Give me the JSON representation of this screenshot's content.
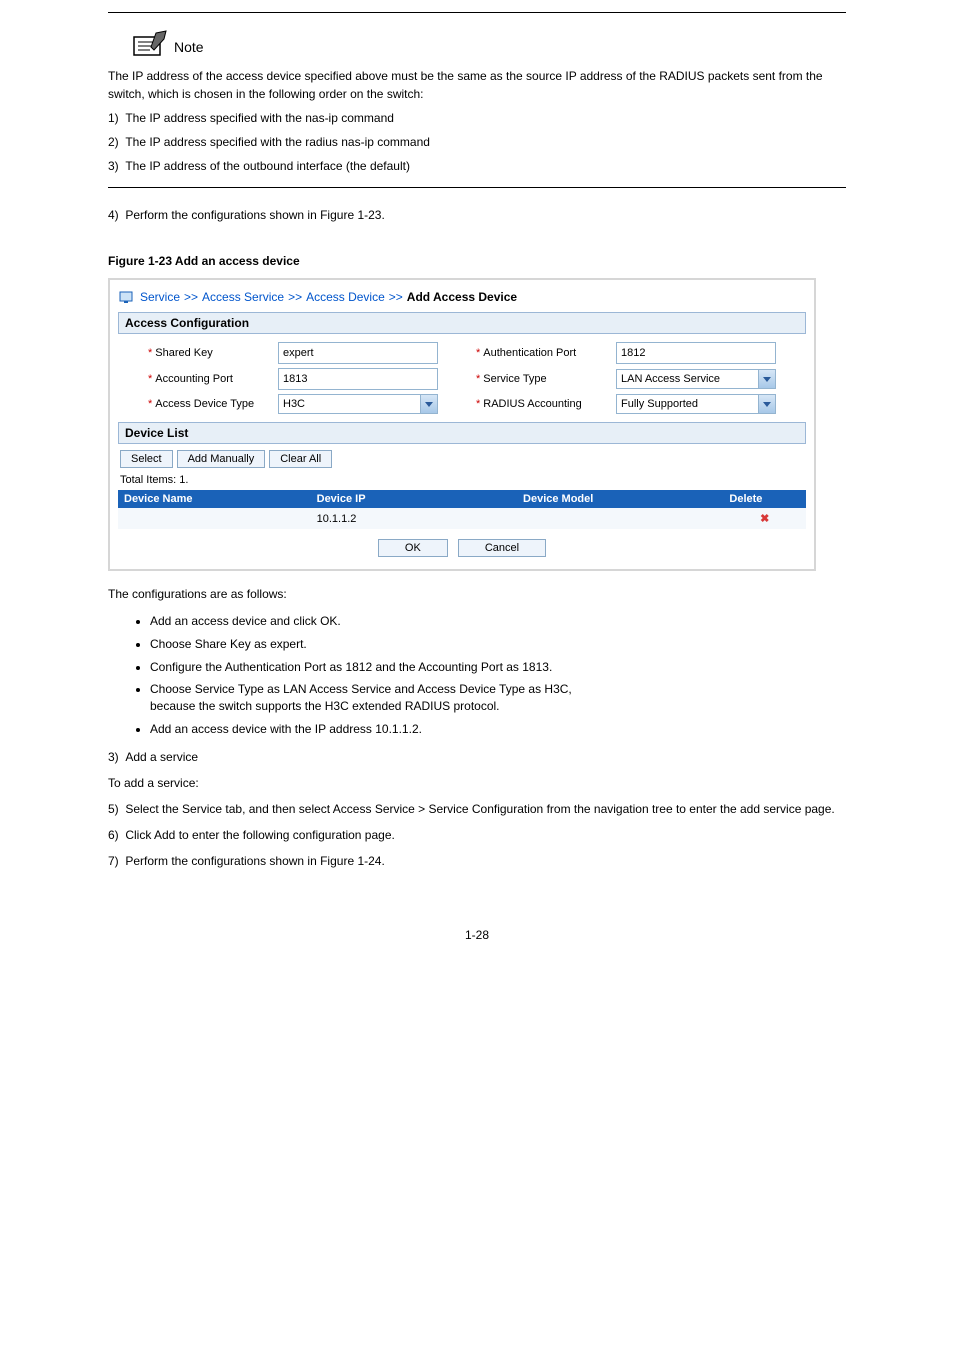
{
  "topRule": true,
  "noteLabel": "Note",
  "noteLines": [
    "The IP address of the access device specified above must be the same as the source IP address of the RADIUS packets sent from the switch, which is chosen in the following order on the switch:",
    "1)  The IP address specified with the nas-ip command",
    "2)  The IP address specified with the radius nas-ip command",
    "3)  The IP address of the outbound interface (the default)"
  ],
  "afterNotePara": "4)  Perform the configurations shown in Figure 1-23.",
  "figure": {
    "caption": "Figure 1-23 Add an access device",
    "breadcrumb": {
      "items": [
        "Service",
        "Access Service",
        "Access Device"
      ],
      "last": "Add Access Device"
    },
    "panels": {
      "accessConfig": {
        "title": "Access Configuration"
      },
      "deviceList": {
        "title": "Device List"
      }
    },
    "form": {
      "sharedKey": {
        "label": "Shared Key",
        "value": "expert"
      },
      "authPort": {
        "label": "Authentication Port",
        "value": "1812"
      },
      "accountingPort": {
        "label": "Accounting Port",
        "value": "1813"
      },
      "serviceType": {
        "label": "Service Type",
        "value": "LAN Access Service"
      },
      "deviceType": {
        "label": "Access Device Type",
        "value": "H3C"
      },
      "radiusAcct": {
        "label": "RADIUS Accounting",
        "value": "Fully Supported"
      }
    },
    "toolbar": {
      "select": "Select",
      "addManual": "Add Manually",
      "clearAll": "Clear All"
    },
    "totalItems": "Total Items: 1.",
    "tableHeaders": {
      "name": "Device Name",
      "ip": "Device IP",
      "model": "Device Model",
      "del": "Delete"
    },
    "rows": [
      {
        "name": "",
        "ip": "10.1.1.2",
        "model": ""
      }
    ],
    "buttons": {
      "ok": "OK",
      "cancel": "Cancel"
    }
  },
  "afterFigurePara": "The configurations are as follows:",
  "confList": [
    "Add an access device and click OK.",
    "Choose Share Key as expert.",
    "Configure the Authentication Port as 1812 and the Accounting Port as 1813.",
    "Choose Service Type as LAN Access Service and Access Device Type as H3C,",
    "because the switch supports the H3C extended RADIUS protocol.",
    "Add an access device with the IP address 10.1.1.2."
  ],
  "heading3": "3)  Add a service",
  "instr3": [
    "To add a service:",
    "5)  Select the Service tab, and then select Access Service > Service Configuration from the navigation tree to enter the add service page.",
    "6)  Click Add to enter the following configuration page.",
    "7)  Perform the configurations shown in Figure 1-24."
  ],
  "pageNum": "1-28"
}
